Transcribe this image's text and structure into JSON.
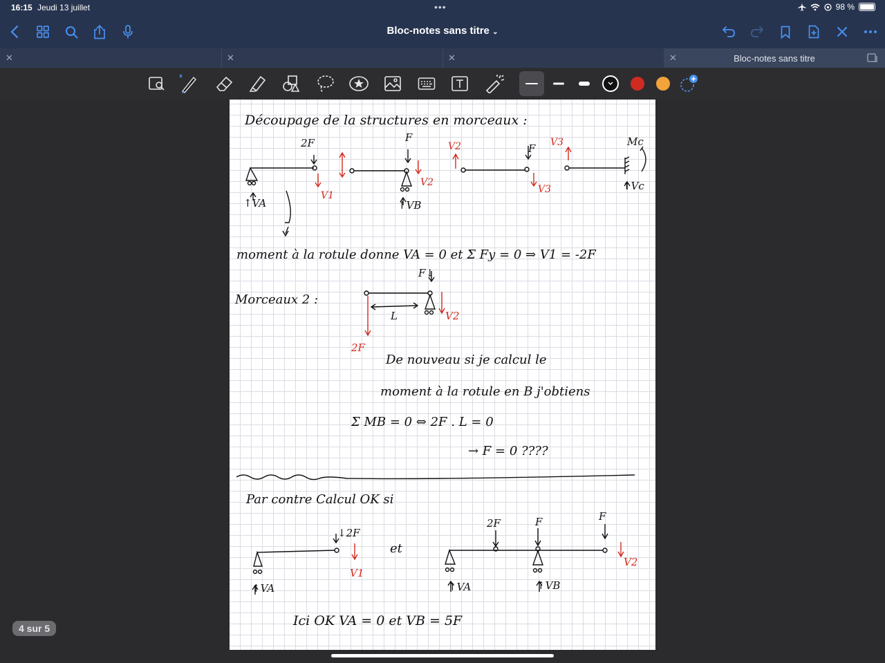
{
  "status_bar": {
    "time": "16:15",
    "date": "Jeudi 13 juillet",
    "battery": "98 %",
    "battery_level": 0.98
  },
  "nav": {
    "title": "Bloc-notes sans titre"
  },
  "tabs": [
    {
      "label": ""
    },
    {
      "label": ""
    },
    {
      "label": ""
    },
    {
      "label": "Bloc-notes sans titre",
      "active": true
    }
  ],
  "toolbar": {
    "tools": [
      "lasso-image-icon",
      "pen-icon",
      "eraser-icon",
      "highlighter-icon",
      "shapes-icon",
      "lasso-icon",
      "sticker-icon",
      "image-icon",
      "keyboard-icon",
      "text-box-icon",
      "laser-pointer-icon"
    ],
    "colors": [
      "#111111",
      "#d12a1f",
      "#f2a33a"
    ]
  },
  "note": {
    "line1": "Découpage de la structures en morceaux :",
    "l_2F": "2F",
    "l_F": "F",
    "l_V1": "V1",
    "l_V2": "V2",
    "l_V3": "V3",
    "l_Mc": "Mc",
    "l_Vc": "↑Vc",
    "l_VA": "↑VA",
    "l_VB": "↑VB",
    "line2": "moment à la rotule donne  VA = 0  et  Σ Fy = 0 ⇒ V1 = -2F",
    "morceaux2": "Morceaux 2 :",
    "l_Fdown": "F↓",
    "l_L": "L",
    "l_2Fred": "2F",
    "text_a": "De nouveau si je calcul le",
    "text_b": "moment à la rotule en B j'obtiens",
    "eq1": "Σ MB = 0  ⇔  2F . L = 0",
    "eq2": "→ F = 0 ????",
    "par_contre": "Par contre Calcul OK si",
    "l_down2F": "↓2F",
    "et": "et",
    "ici": "Ici  OK    VA = 0   et   VB = 5F"
  },
  "page_counter": "4 sur 5"
}
